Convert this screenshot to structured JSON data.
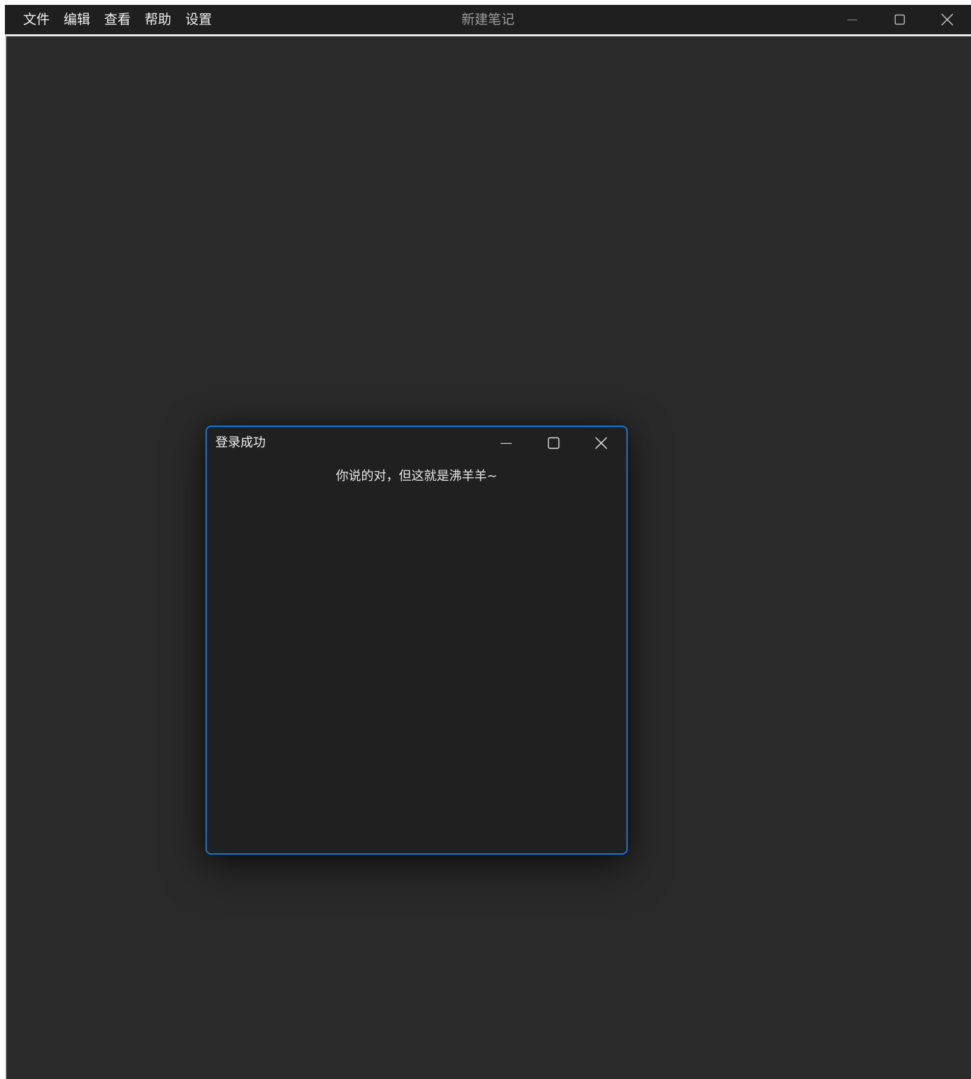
{
  "app": {
    "menu": [
      {
        "label": "文件"
      },
      {
        "label": "编辑"
      },
      {
        "label": "查看"
      },
      {
        "label": "帮助"
      },
      {
        "label": "设置"
      }
    ],
    "title": "新建笔记",
    "controls": {
      "minimize_icon": "minimize-icon",
      "maximize_icon": "maximize-icon",
      "close_icon": "close-icon"
    }
  },
  "dialog": {
    "title": "登录成功",
    "message": "你说的对，但这就是沸羊羊~",
    "accent_color": "#1e74c8"
  },
  "colors": {
    "background": "#2a2a2a",
    "titlebar": "#1f1f1f",
    "dialog_background": "#202020"
  }
}
